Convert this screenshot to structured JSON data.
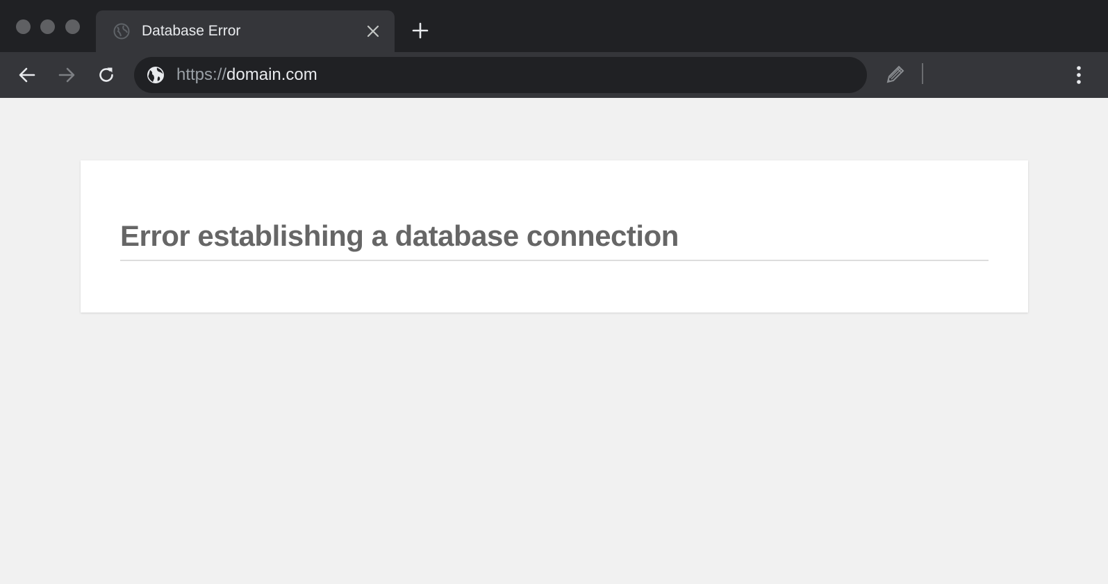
{
  "tab": {
    "title": "Database Error",
    "favicon": "globe-icon",
    "close_icon": "close-icon"
  },
  "toolbar": {
    "back_icon": "arrow-left-icon",
    "forward_icon": "arrow-right-icon",
    "reload_icon": "reload-icon",
    "new_tab_icon": "plus-icon",
    "extension_icon": "pencil-icon",
    "menu_icon": "kebab-menu-icon"
  },
  "address_bar": {
    "scheme": "https://",
    "host": "domain.com",
    "site_icon": "globe-icon"
  },
  "page": {
    "heading": "Error establishing a database connection"
  },
  "colors": {
    "tabstrip_bg": "#202124",
    "toolbar_bg": "#35363a",
    "page_bg": "#f1f1f1",
    "card_bg": "#ffffff",
    "heading_text": "#666666"
  }
}
